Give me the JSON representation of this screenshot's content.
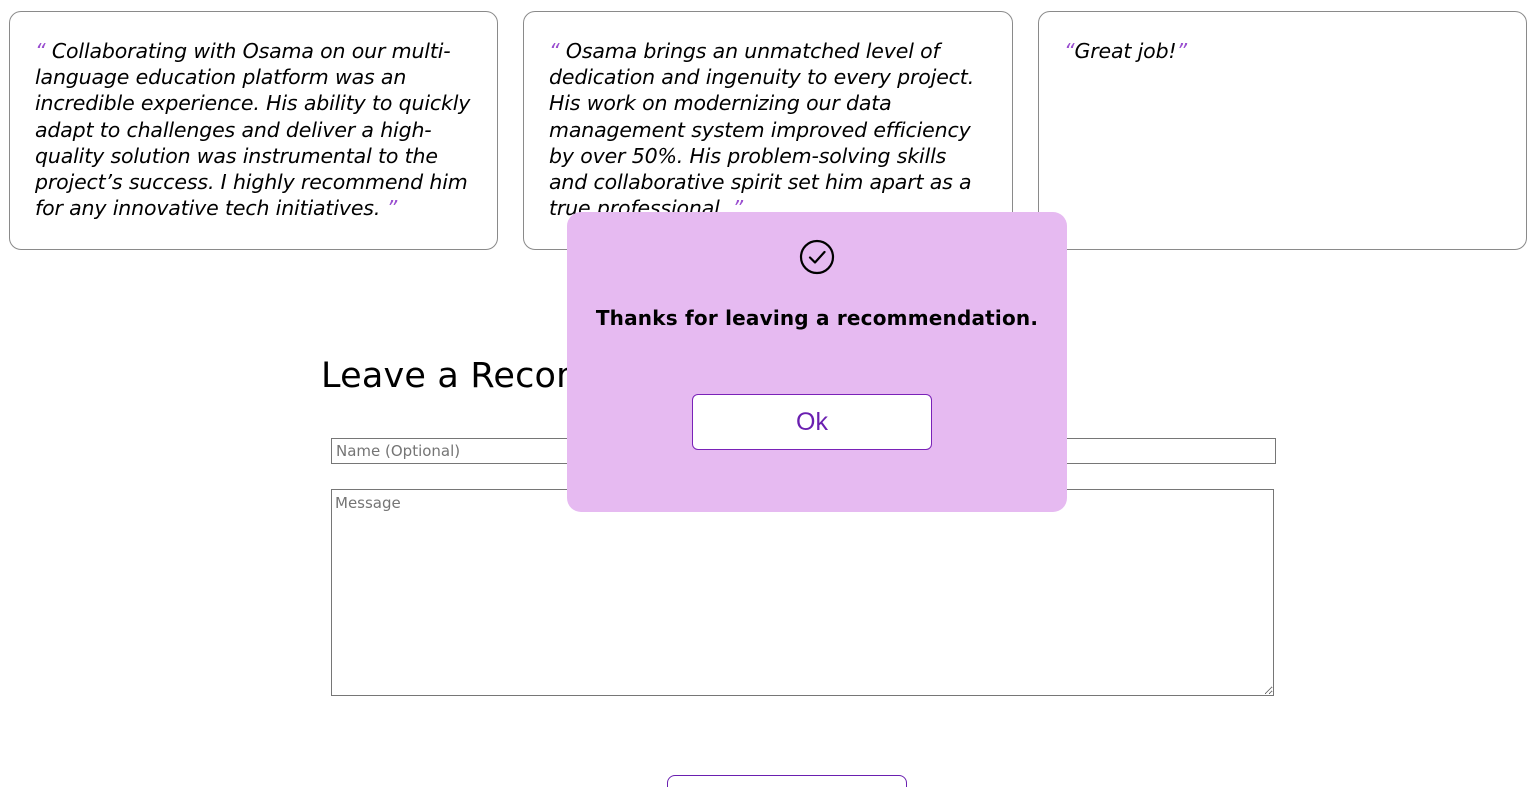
{
  "recommendations": [
    {
      "open_quote": "“",
      "text": " Collaborating with Osama on our multi-language education platform was an incredible experience. His ability to quickly adapt to challenges and deliver a high-quality solution was instrumental to the project’s success. I highly recommend him for any innovative tech initiatives. ",
      "close_quote": "”"
    },
    {
      "open_quote": "“",
      "text": " Osama brings an unmatched level of dedication and ingenuity to every project. His work on modernizing our data management system improved efficiency by over 50%. His problem-solving skills and collaborative spirit set him apart as a true professional. ",
      "close_quote": "”"
    },
    {
      "open_quote": "“",
      "text": "Great job!",
      "close_quote": "”"
    }
  ],
  "form": {
    "title": "Leave a Recommendation",
    "name_placeholder": "Name (Optional)",
    "name_value": "",
    "message_placeholder": "Message",
    "message_value": ""
  },
  "modal": {
    "icon": "check-circle-icon",
    "message": "Thanks for leaving a recommendation.",
    "ok_label": "Ok"
  },
  "colors": {
    "accent": "#6a1fb0",
    "quote_mark": "#9a4fd0",
    "modal_background": "#e6baf1"
  }
}
